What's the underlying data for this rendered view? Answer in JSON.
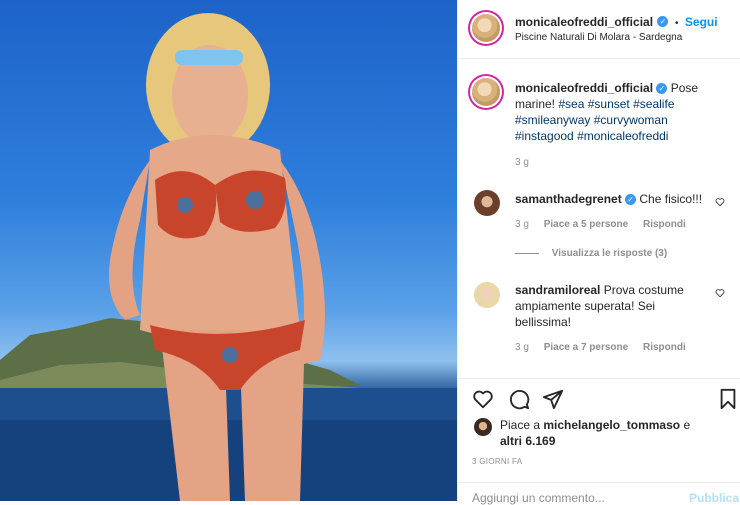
{
  "post": {
    "author": "monicaleofreddi_official",
    "follow_label": "Segui",
    "separator": "•",
    "location": "Piscine Naturali Di Molara - Sardegna"
  },
  "caption": {
    "author": "monicaleofreddi_official",
    "text_lead": "Pose marine!",
    "hashtags": [
      "#sea",
      "#sunset",
      "#sealife",
      "#smileanyway",
      "#curvywoman",
      "#instagood",
      "#monicaleofreddi"
    ],
    "time": "3 g"
  },
  "comments": [
    {
      "author": "samanthadegrenet",
      "verified": true,
      "text": "Che fisico!!!",
      "time": "3 g",
      "likes": "Piace a 5 persone",
      "reply": "Rispondi",
      "view_replies": "Visualizza le risposte (3)"
    },
    {
      "author": "sandramiloreal",
      "verified": false,
      "text_lines": [
        "Prova costume",
        "ampiamente superata! Sei",
        "bellissima!"
      ],
      "time": "3 g",
      "likes": "Piace a 7 persone",
      "reply": "Rispondi"
    }
  ],
  "likes_line": {
    "prefix": "Piace a",
    "user": "michelangelo_tommaso",
    "suffix": "e",
    "others": "altri 6.169"
  },
  "timestamp": "3 GIORNI FA",
  "comment_input": {
    "placeholder": "Aggiungi un commento...",
    "publish": "Pubblica"
  },
  "icons": [
    "heart-icon",
    "comment-icon",
    "share-icon",
    "bookmark-icon",
    "verified-icon"
  ],
  "colors": {
    "link": "#0095f6",
    "hashtag": "#00376b",
    "verified": "#3897f0",
    "muted": "#8e8e8e",
    "sky": "#2f7fdc"
  }
}
